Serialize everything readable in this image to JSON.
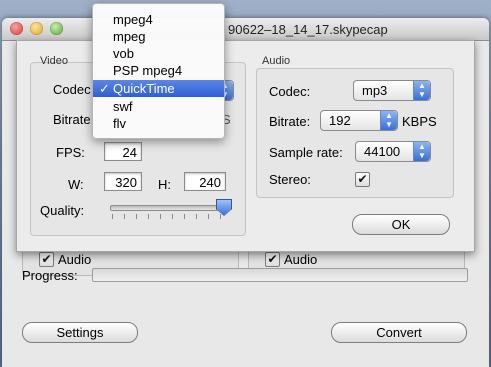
{
  "window": {
    "title": "90622–18_14_17.skypecap"
  },
  "main": {
    "video_audio_checkbox": {
      "label": "Audio",
      "checked": "✔"
    },
    "audio_audio_checkbox": {
      "label": "Audio",
      "checked": "✔"
    },
    "progress_label": "Progress:",
    "progress_value": 0,
    "settings_button": "Settings",
    "convert_button": "Convert"
  },
  "video": {
    "group_title": "Video",
    "codec_label": "Codec",
    "bitrate_label": "Bitrate",
    "bitrate_unit_fragment": "S",
    "fps_label": "FPS:",
    "fps_value": "24",
    "width_label": "W:",
    "width_value": "320",
    "height_label": "H:",
    "height_value": "240",
    "quality_label": "Quality:",
    "quality_level": 1.0
  },
  "audio": {
    "group_title": "Audio",
    "codec_label": "Codec:",
    "codec_value": "mp3",
    "bitrate_label": "Bitrate:",
    "bitrate_value": "192",
    "bitrate_unit": "KBPS",
    "sample_rate_label": "Sample rate:",
    "sample_rate_value": "44100",
    "stereo_label": "Stereo:",
    "stereo_checked": "✔"
  },
  "ok_button": "OK",
  "codec_menu": {
    "items": [
      "mpeg4",
      "mpeg",
      "vob",
      "PSP mpeg4",
      "QuickTime",
      "swf",
      "flv"
    ],
    "selected": "QuickTime",
    "check_mark": "✓"
  },
  "colors": {
    "selection": "#2f5fd6",
    "accent": "#3a6fd6"
  }
}
